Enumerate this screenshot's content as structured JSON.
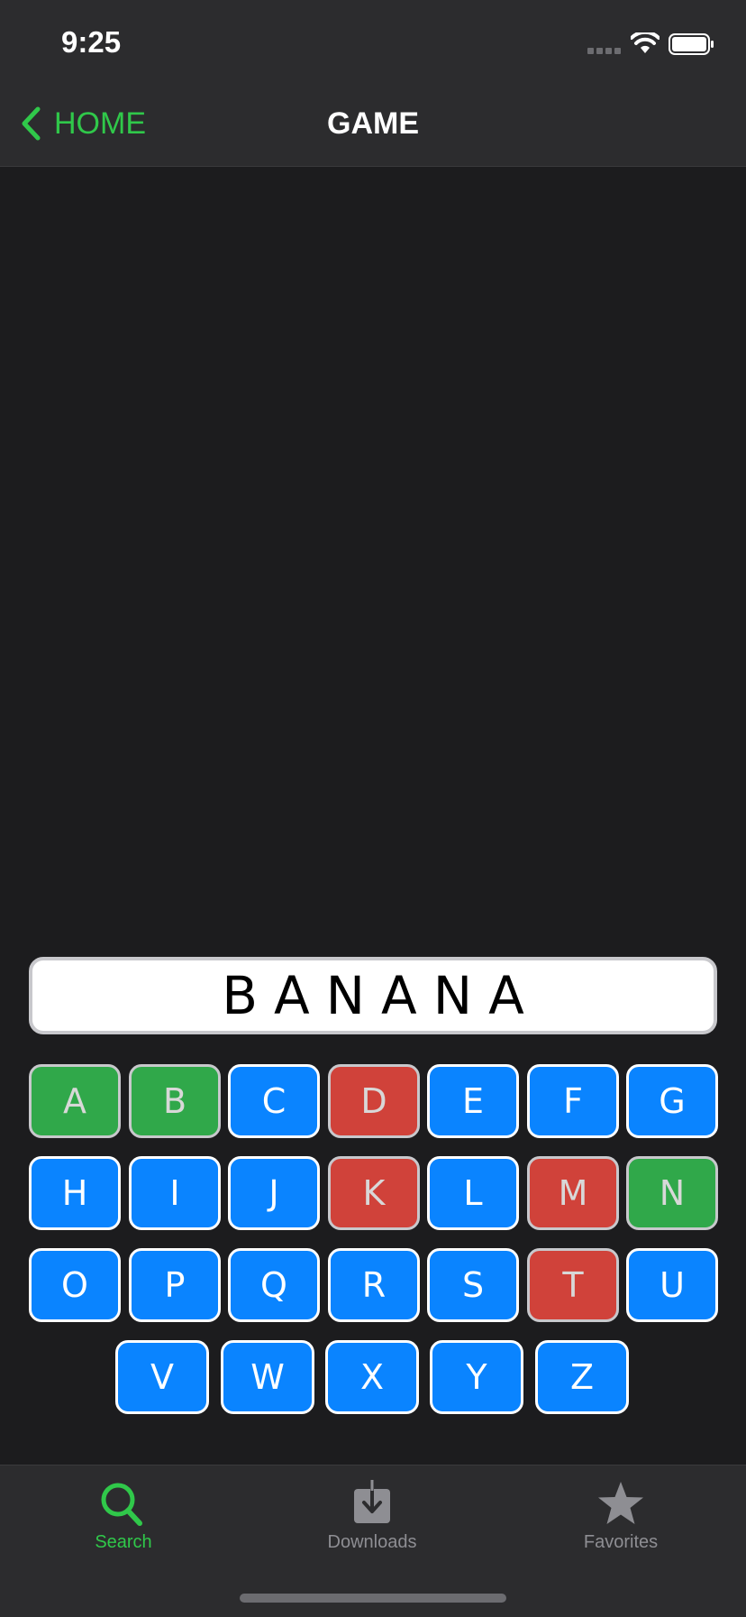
{
  "status_bar": {
    "time": "9:25"
  },
  "nav": {
    "back_label": "HOME",
    "title": "GAME"
  },
  "word": "BANANA",
  "keyboard": {
    "rows": [
      [
        {
          "letter": "A",
          "state": "correct"
        },
        {
          "letter": "B",
          "state": "correct"
        },
        {
          "letter": "C",
          "state": "unused"
        },
        {
          "letter": "D",
          "state": "wrong"
        },
        {
          "letter": "E",
          "state": "unused"
        },
        {
          "letter": "F",
          "state": "unused"
        },
        {
          "letter": "G",
          "state": "unused"
        }
      ],
      [
        {
          "letter": "H",
          "state": "unused"
        },
        {
          "letter": "I",
          "state": "unused"
        },
        {
          "letter": "J",
          "state": "unused"
        },
        {
          "letter": "K",
          "state": "wrong"
        },
        {
          "letter": "L",
          "state": "unused"
        },
        {
          "letter": "M",
          "state": "wrong"
        },
        {
          "letter": "N",
          "state": "correct"
        }
      ],
      [
        {
          "letter": "O",
          "state": "unused"
        },
        {
          "letter": "P",
          "state": "unused"
        },
        {
          "letter": "Q",
          "state": "unused"
        },
        {
          "letter": "R",
          "state": "unused"
        },
        {
          "letter": "S",
          "state": "unused"
        },
        {
          "letter": "T",
          "state": "wrong"
        },
        {
          "letter": "U",
          "state": "unused"
        }
      ],
      [
        {
          "letter": "V",
          "state": "unused"
        },
        {
          "letter": "W",
          "state": "unused"
        },
        {
          "letter": "X",
          "state": "unused"
        },
        {
          "letter": "Y",
          "state": "unused"
        },
        {
          "letter": "Z",
          "state": "unused"
        }
      ]
    ]
  },
  "tab_bar": {
    "tabs": [
      {
        "label": "Search",
        "icon": "search-icon",
        "active": true
      },
      {
        "label": "Downloads",
        "icon": "download-icon",
        "active": false
      },
      {
        "label": "Favorites",
        "icon": "star-icon",
        "active": false
      }
    ]
  },
  "colors": {
    "accent": "#30c84a",
    "key_unused": "#0a84ff",
    "key_correct": "#30a84a",
    "key_wrong": "#d0423a",
    "background": "#1c1c1e",
    "bar": "#2c2c2e",
    "inactive_tab": "#8e8e93"
  }
}
